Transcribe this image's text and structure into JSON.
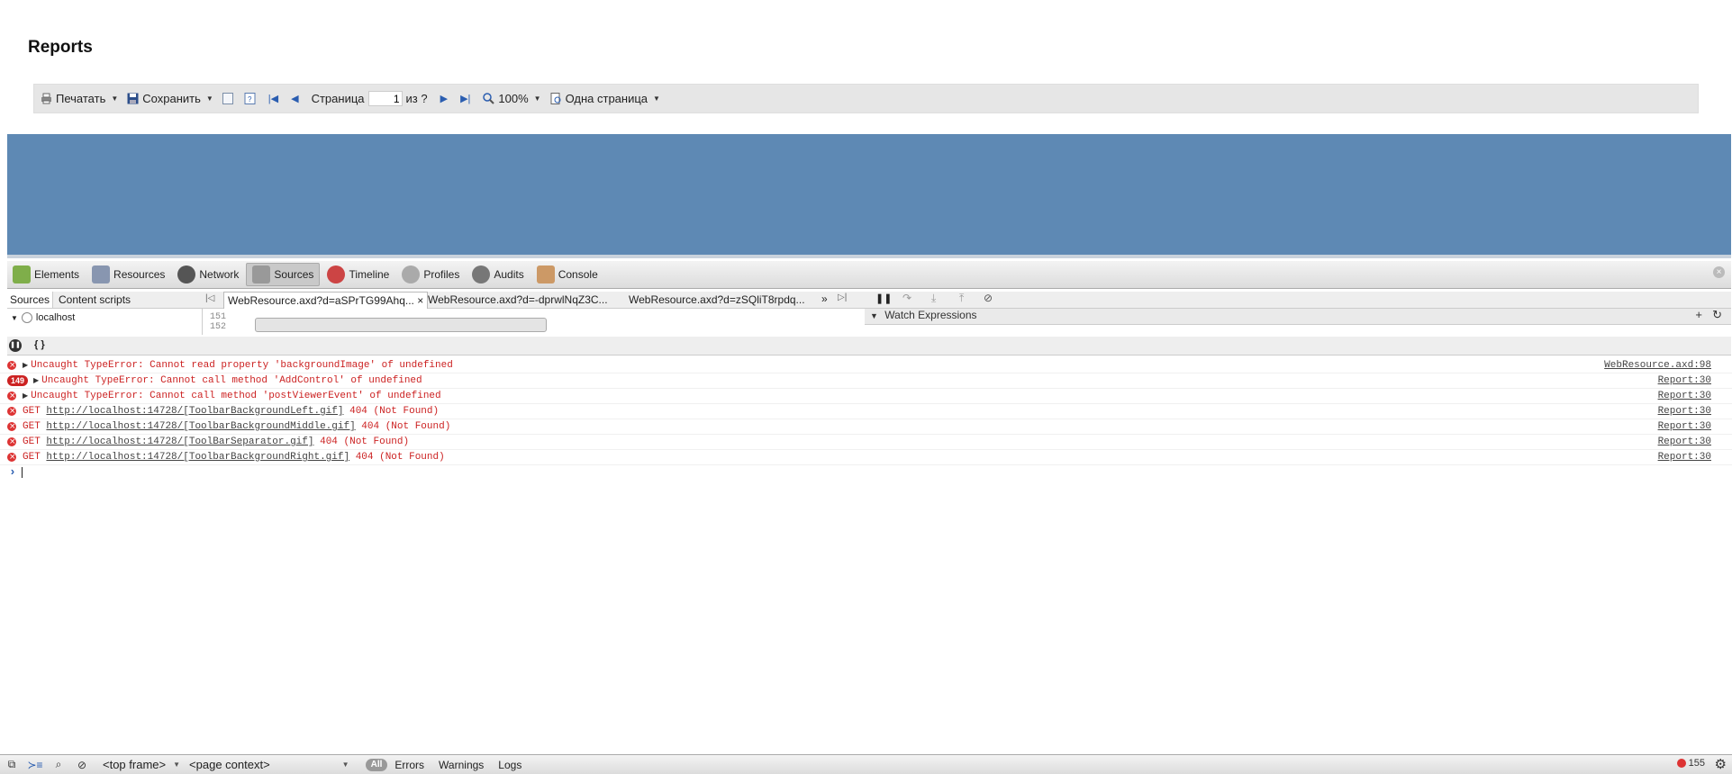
{
  "page": {
    "heading": "Reports"
  },
  "report_toolbar": {
    "print_label": "Печатать",
    "save_label": "Сохранить",
    "page_label": "Страница",
    "page_value": "1",
    "of_label": "из ?",
    "zoom_label": "100%",
    "view_label": "Одна страница"
  },
  "devtools": {
    "tabs": [
      {
        "label": "Elements",
        "icon": "elements-icon"
      },
      {
        "label": "Resources",
        "icon": "resources-icon"
      },
      {
        "label": "Network",
        "icon": "network-icon"
      },
      {
        "label": "Sources",
        "icon": "sources-icon",
        "active": true
      },
      {
        "label": "Timeline",
        "icon": "timeline-icon"
      },
      {
        "label": "Profiles",
        "icon": "profiles-icon"
      },
      {
        "label": "Audits",
        "icon": "audits-icon"
      },
      {
        "label": "Console",
        "icon": "console-icon"
      }
    ],
    "sources": {
      "panel_tabs": [
        "Sources",
        "Content scripts"
      ],
      "file_tabs": [
        "WebResource.axd?d=aSPrTG99Ahq...",
        "WebResource.axd?d=-dprwlNqZ3C...",
        "WebResource.axd?d=zSQliT8rpdq..."
      ],
      "tree_item": "localhost",
      "line_numbers": [
        "151",
        "152"
      ],
      "watch_header": "Watch Expressions"
    },
    "console": {
      "messages": [
        {
          "text": "Uncaught TypeError: Cannot read property 'backgroundImage' of undefined",
          "source": "WebResource.axd:98",
          "expandable": true
        },
        {
          "count": "149",
          "text": "Uncaught TypeError: Cannot call method 'AddControl' of undefined",
          "source": "Report:30",
          "expandable": true
        },
        {
          "text": "Uncaught TypeError: Cannot call method 'postViewerEvent' of undefined",
          "source": "Report:30",
          "expandable": true
        },
        {
          "prefix": "GET",
          "url": "http://localhost:14728/[ToolbarBackgroundLeft.gif]",
          "status": "404 (Not Found)",
          "source": "Report:30"
        },
        {
          "prefix": "GET",
          "url": "http://localhost:14728/[ToolbarBackgroundMiddle.gif]",
          "status": "404 (Not Found)",
          "source": "Report:30"
        },
        {
          "prefix": "GET",
          "url": "http://localhost:14728/[ToolBarSeparator.gif]",
          "status": "404 (Not Found)",
          "source": "Report:30"
        },
        {
          "prefix": "GET",
          "url": "http://localhost:14728/[ToolbarBackgroundRight.gif]",
          "status": "404 (Not Found)",
          "source": "Report:30"
        }
      ]
    },
    "bottom_bar": {
      "frame_select": "<top frame>",
      "context_select": "<page context>",
      "filter_all": "All",
      "filters": [
        "Errors",
        "Warnings",
        "Logs"
      ],
      "error_count": "155"
    }
  },
  "colors": {
    "report_area": "#5e89b4",
    "error_text": "#cc2222"
  }
}
